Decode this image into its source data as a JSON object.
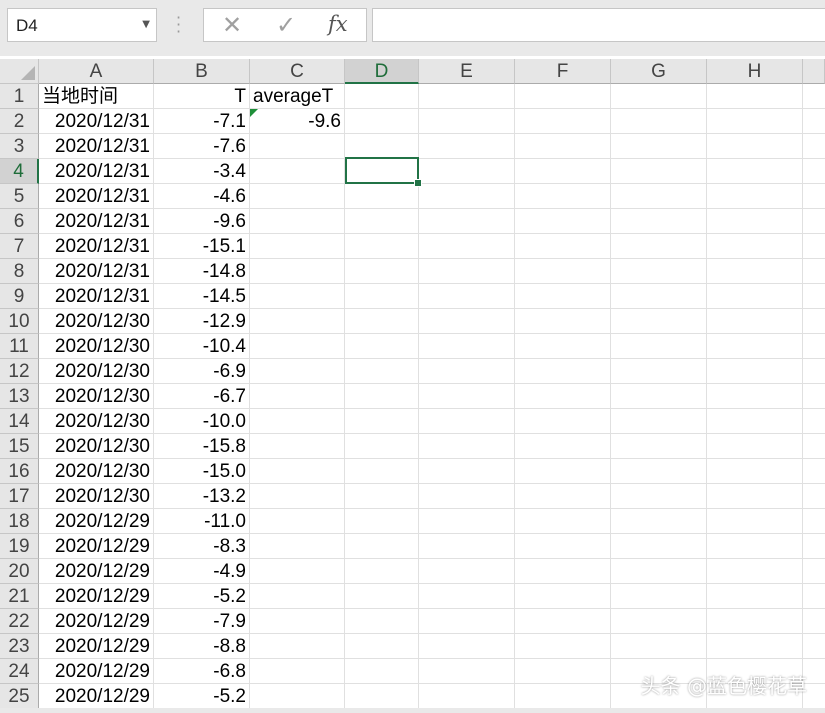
{
  "name_box": {
    "value": "D4",
    "dropdown_icon": "caret-down-icon"
  },
  "formula_bar": {
    "cancel_icon": "cancel-x-icon",
    "enter_icon": "checkmark-icon",
    "fx_label": "fx",
    "formula": ""
  },
  "columns": [
    "A",
    "B",
    "C",
    "D",
    "E",
    "F",
    "G",
    "H"
  ],
  "selected_column": "D",
  "selected_row": "4",
  "rows": [
    {
      "num": "1",
      "a": "当地时间",
      "b": "T",
      "c": "averageT"
    },
    {
      "num": "2",
      "a": "2020/12/31",
      "b": "-7.1",
      "c": "-9.6"
    },
    {
      "num": "3",
      "a": "2020/12/31",
      "b": "-7.6",
      "c": ""
    },
    {
      "num": "4",
      "a": "2020/12/31",
      "b": "-3.4",
      "c": ""
    },
    {
      "num": "5",
      "a": "2020/12/31",
      "b": "-4.6",
      "c": ""
    },
    {
      "num": "6",
      "a": "2020/12/31",
      "b": "-9.6",
      "c": ""
    },
    {
      "num": "7",
      "a": "2020/12/31",
      "b": "-15.1",
      "c": ""
    },
    {
      "num": "8",
      "a": "2020/12/31",
      "b": "-14.8",
      "c": ""
    },
    {
      "num": "9",
      "a": "2020/12/31",
      "b": "-14.5",
      "c": ""
    },
    {
      "num": "10",
      "a": "2020/12/30",
      "b": "-12.9",
      "c": ""
    },
    {
      "num": "11",
      "a": "2020/12/30",
      "b": "-10.4",
      "c": ""
    },
    {
      "num": "12",
      "a": "2020/12/30",
      "b": "-6.9",
      "c": ""
    },
    {
      "num": "13",
      "a": "2020/12/30",
      "b": "-6.7",
      "c": ""
    },
    {
      "num": "14",
      "a": "2020/12/30",
      "b": "-10.0",
      "c": ""
    },
    {
      "num": "15",
      "a": "2020/12/30",
      "b": "-15.8",
      "c": ""
    },
    {
      "num": "16",
      "a": "2020/12/30",
      "b": "-15.0",
      "c": ""
    },
    {
      "num": "17",
      "a": "2020/12/30",
      "b": "-13.2",
      "c": ""
    },
    {
      "num": "18",
      "a": "2020/12/29",
      "b": "-11.0",
      "c": ""
    },
    {
      "num": "19",
      "a": "2020/12/29",
      "b": "-8.3",
      "c": ""
    },
    {
      "num": "20",
      "a": "2020/12/29",
      "b": "-4.9",
      "c": ""
    },
    {
      "num": "21",
      "a": "2020/12/29",
      "b": "-5.2",
      "c": ""
    },
    {
      "num": "22",
      "a": "2020/12/29",
      "b": "-7.9",
      "c": ""
    },
    {
      "num": "23",
      "a": "2020/12/29",
      "b": "-8.8",
      "c": ""
    },
    {
      "num": "24",
      "a": "2020/12/29",
      "b": "-6.8",
      "c": ""
    },
    {
      "num": "25",
      "a": "2020/12/29",
      "b": "-5.2",
      "c": ""
    }
  ],
  "watermark": "头条 @蓝色樱花草",
  "colors": {
    "selection": "#217346",
    "header_bg": "#e6e6e6",
    "grid": "#e0e0e0"
  }
}
